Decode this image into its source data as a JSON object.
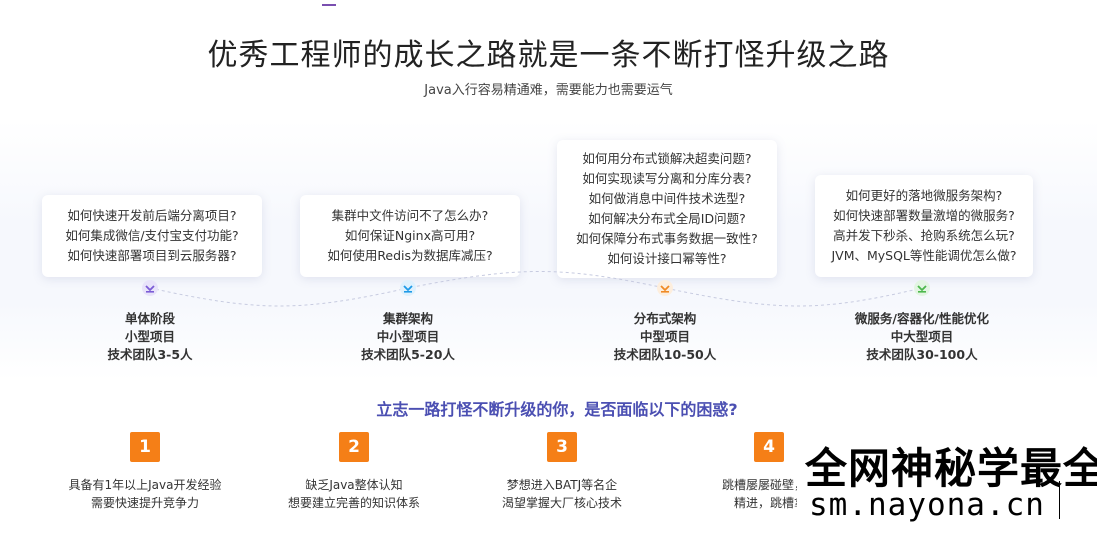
{
  "header": {
    "title": "优秀工程师的成长之路就是一条不断打怪升级之路",
    "subtitle": "Java入行容易精通难，需要能力也需要运气"
  },
  "stages": [
    {
      "questions": [
        "如何快速开发前后端分离项目?",
        "如何集成微信/支付宝支付功能?",
        "如何快速部署项目到云服务器?"
      ],
      "name": "单体阶段",
      "scale": "小型项目",
      "team": "技术团队3-5人",
      "color": "#7b5cd6"
    },
    {
      "questions": [
        "集群中文件访问不了怎么办?",
        "如何保证Nginx高可用?",
        "如何使用Redis为数据库减压?"
      ],
      "name": "集群架构",
      "scale": "中小型项目",
      "team": "技术团队5-20人",
      "color": "#1e9be8"
    },
    {
      "questions": [
        "如何用分布式锁解决超卖问题?",
        "如何实现读写分离和分库分表?",
        "如何做消息中间件技术选型?",
        "如何解决分布式全局ID问题?",
        "如何保障分布式事务数据一致性?",
        "如何设计接口幂等性?"
      ],
      "name": "分布式架构",
      "scale": "中型项目",
      "team": "技术团队10-50人",
      "color": "#f08a24"
    },
    {
      "questions": [
        "如何更好的落地微服务架构?",
        "如何快速部署数量激增的微服务?",
        "高并发下秒杀、抢购系统怎么玩?",
        "JVM、MySQL等性能调优怎么做?"
      ],
      "name": "微服务/容器化/性能优化",
      "scale": "中大型项目",
      "team": "技术团队30-100人",
      "color": "#4cb84c"
    }
  ],
  "question_line": "立志一路打怪不断升级的你，是否面临以下的困惑?",
  "pains": [
    {
      "num": "1",
      "lines": [
        "具备有1年以上Java开发经验",
        "需要快速提升竞争力"
      ]
    },
    {
      "num": "2",
      "lines": [
        "缺乏Java整体认知",
        "想要建立完善的知识体系"
      ]
    },
    {
      "num": "3",
      "lines": [
        "梦想进入BATJ等名企",
        "渴望掌握大厂核心技术"
      ]
    },
    {
      "num": "4",
      "lines": [
        "跳槽屡屡碰壁，急",
        "精进，跳槽拿"
      ]
    }
  ],
  "watermark": {
    "line1": "全网神秘学最全",
    "line2": "sm.nayona.cn"
  },
  "colors": {
    "accent": "#4b4fb2",
    "badge": "#f57f17"
  }
}
